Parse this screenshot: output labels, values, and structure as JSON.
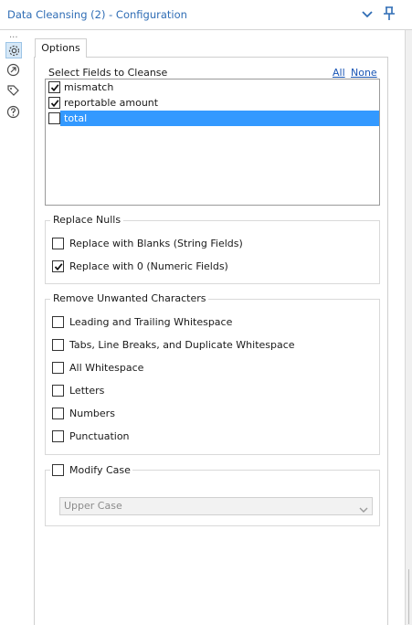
{
  "window": {
    "title": "Data Cleansing (2) - Configuration",
    "title_color": "#2f6db5"
  },
  "rail": {
    "overflow": "...",
    "icons": [
      "gear-icon",
      "navigate-icon",
      "tag-icon",
      "help-icon"
    ]
  },
  "tabs": [
    {
      "label": "Options",
      "active": true
    }
  ],
  "fields_section": {
    "label": "Select Fields to Cleanse",
    "link_all": "All",
    "link_none": "None",
    "items": [
      {
        "label": "mismatch",
        "checked": true,
        "selected": false
      },
      {
        "label": "reportable amount",
        "checked": true,
        "selected": false
      },
      {
        "label": "total",
        "checked": false,
        "selected": true
      }
    ]
  },
  "replace_nulls": {
    "title": "Replace Nulls",
    "options": [
      {
        "label": "Replace with Blanks (String Fields)",
        "checked": false
      },
      {
        "label": "Replace with 0 (Numeric Fields)",
        "checked": true
      }
    ]
  },
  "remove_chars": {
    "title": "Remove Unwanted Characters",
    "options": [
      {
        "label": "Leading and Trailing Whitespace",
        "checked": false
      },
      {
        "label": "Tabs, Line Breaks, and Duplicate Whitespace",
        "checked": false
      },
      {
        "label": "All Whitespace",
        "checked": false
      },
      {
        "label": "Letters",
        "checked": false
      },
      {
        "label": "Numbers",
        "checked": false
      },
      {
        "label": "Punctuation",
        "checked": false
      }
    ]
  },
  "modify_case": {
    "label": "Modify Case",
    "checked": false,
    "select_value": "Upper Case",
    "select_enabled": false
  },
  "colors": {
    "selection": "#3399ff",
    "link": "#1a56b5",
    "active_icon_bg": "#d6e8f7"
  }
}
